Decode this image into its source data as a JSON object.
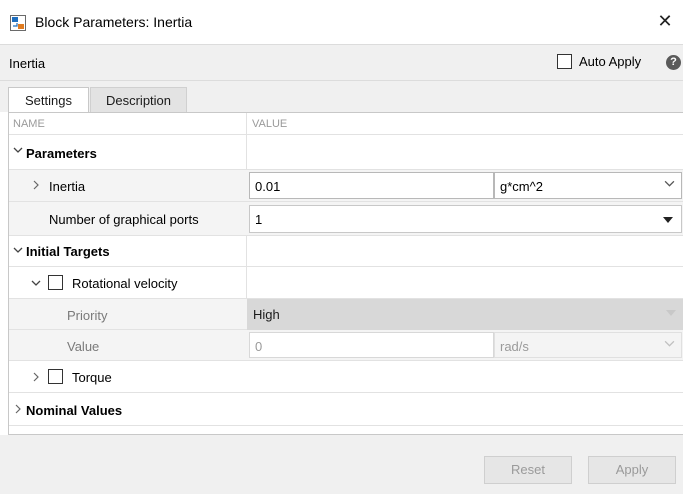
{
  "window": {
    "title": "Block Parameters: Inertia",
    "close_glyph": "✕"
  },
  "header": {
    "block_name": "Inertia",
    "auto_apply_label": "Auto Apply",
    "auto_apply_checked": false,
    "help_glyph": "?"
  },
  "tabs": [
    {
      "label": "Settings",
      "active": true
    },
    {
      "label": "Description",
      "active": false
    }
  ],
  "columns": {
    "name": "NAME",
    "value": "VALUE"
  },
  "sections": {
    "parameters": {
      "label": "Parameters",
      "expanded": true,
      "inertia": {
        "label": "Inertia",
        "value": "0.01",
        "unit": "g*cm^2"
      },
      "ports": {
        "label": "Number of graphical ports",
        "value": "1"
      }
    },
    "initial_targets": {
      "label": "Initial Targets",
      "expanded": true,
      "rotational_velocity": {
        "label": "Rotational velocity",
        "checked": false,
        "expanded": true,
        "priority": {
          "label": "Priority",
          "value": "High"
        },
        "value": {
          "label": "Value",
          "value": "0",
          "unit": "rad/s"
        }
      },
      "torque": {
        "label": "Torque",
        "checked": false,
        "expanded": false
      }
    },
    "nominal_values": {
      "label": "Nominal Values",
      "expanded": false
    }
  },
  "footer": {
    "reset_label": "Reset",
    "apply_label": "Apply"
  },
  "icons": {
    "app": "simulink-block-icon",
    "expand": "chevron-down-icon",
    "collapse": "chevron-right-icon",
    "dropdown": "chevron-down-icon",
    "help": "help-icon"
  },
  "colors": {
    "header_bg": "#f0f0f0",
    "gray_row": "#f4f4f4",
    "border": "#c8c8c8"
  }
}
